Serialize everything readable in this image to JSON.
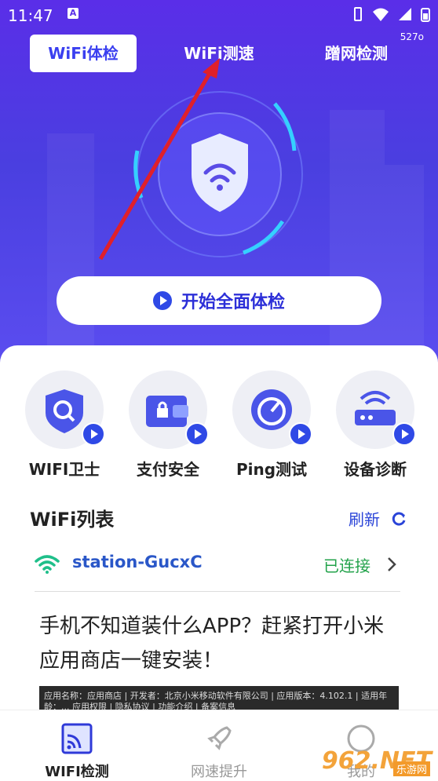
{
  "status": {
    "time": "11:47",
    "a_badge": "A",
    "speed": "527o"
  },
  "tabs": [
    {
      "label": "WiFi体检"
    },
    {
      "label": "WiFi测速"
    },
    {
      "label": "蹭网检测"
    }
  ],
  "start_button": {
    "label": "开始全面体检"
  },
  "features": [
    {
      "label": "WIFI卫士",
      "icon": "shield-search-icon"
    },
    {
      "label": "支付安全",
      "icon": "wallet-lock-icon"
    },
    {
      "label": "Ping测试",
      "icon": "gauge-icon"
    },
    {
      "label": "设备诊断",
      "icon": "router-icon"
    }
  ],
  "wifi_list": {
    "title": "WiFi列表",
    "refresh_label": "刷新",
    "items": [
      {
        "ssid": "station-GucxC",
        "status": "已连接"
      }
    ]
  },
  "ad": {
    "text": "手机不知道装什么APP？赶紧打开小米应用商店一键安装！",
    "caption": "应用名称：应用商店 | 开发者：北京小米移动软件有限公司 | 应用版本：4.102.1 | 适用年龄：... 应用权限 | 隐私协议 | 功能介绍 | 备案信息"
  },
  "nav": [
    {
      "label": "WIFI检测",
      "icon": "wifi-screen-icon"
    },
    {
      "label": "网速提升",
      "icon": "rocket-icon"
    },
    {
      "label": "我的",
      "icon": "user-icon"
    }
  ],
  "watermark": {
    "main": "962.NET",
    "sub": "乐游网"
  },
  "colors": {
    "primary": "#3a3ff0",
    "connected": "#22a24a",
    "link": "#2a44d8"
  }
}
